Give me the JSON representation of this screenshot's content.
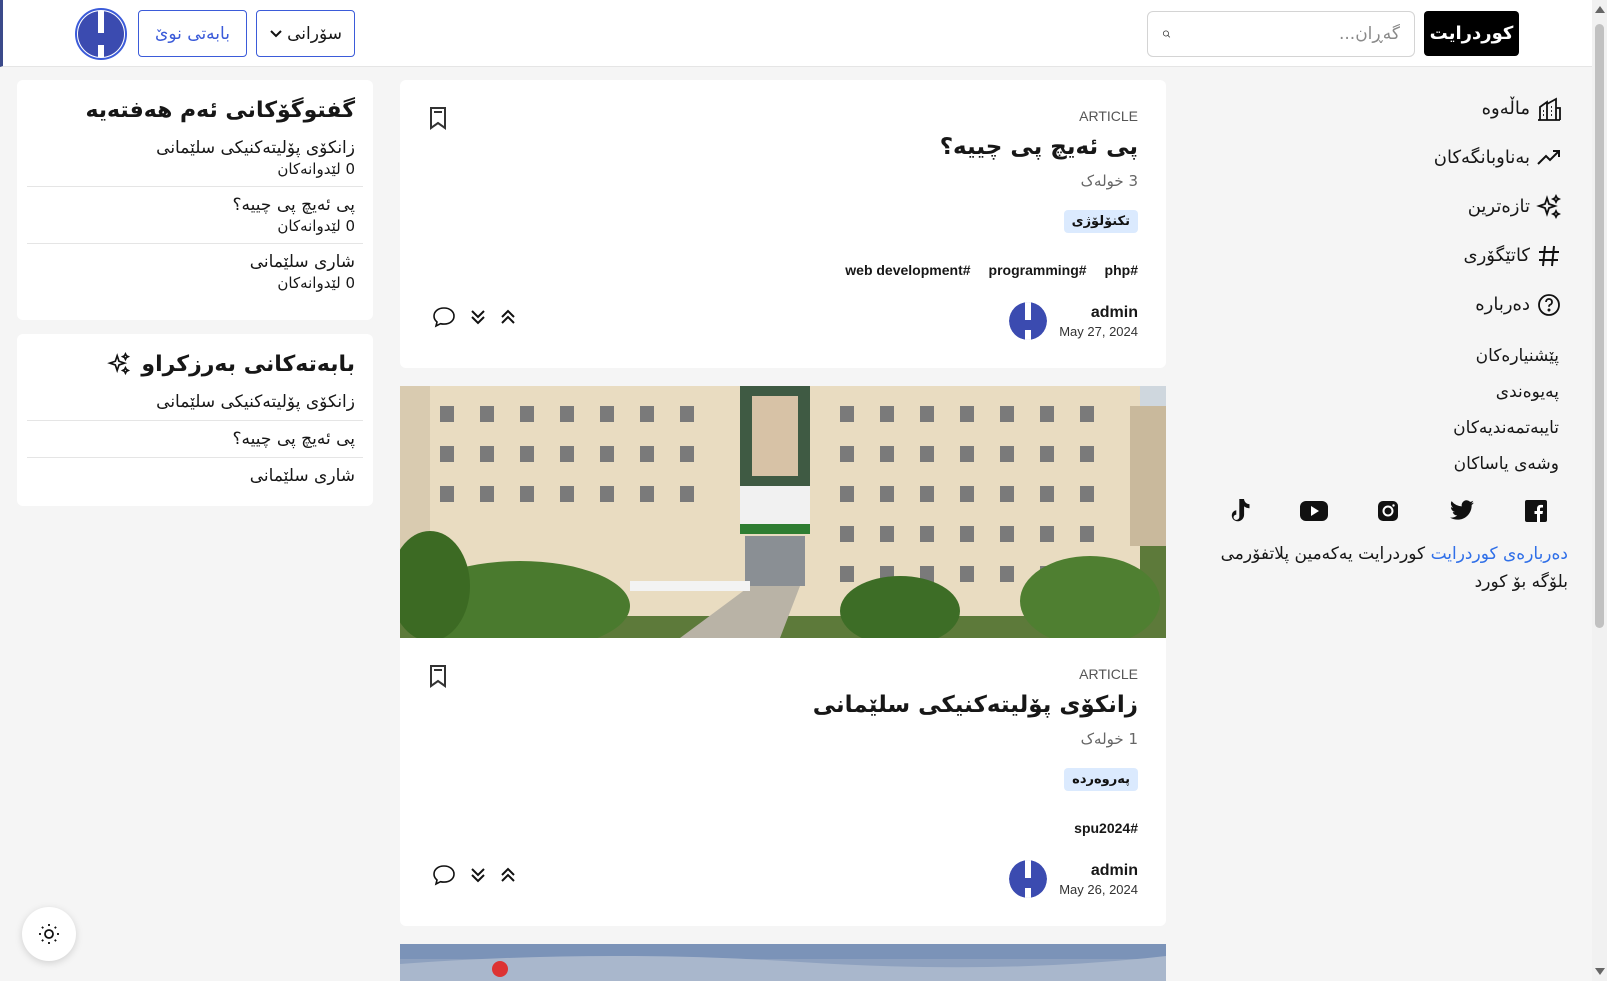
{
  "header": {
    "brand": "کوردرایت",
    "search_placeholder": "گەڕان...",
    "language_selected": "سۆرانی",
    "new_post_label": "بابەتی نوێ"
  },
  "nav": {
    "items": [
      {
        "label": "ماڵەوە",
        "icon": "home-icon"
      },
      {
        "label": "بەناوبانگەکان",
        "icon": "trending-icon"
      },
      {
        "label": "تازەترین",
        "icon": "sparkles-icon"
      },
      {
        "label": "کاتێگۆری",
        "icon": "hash-icon"
      },
      {
        "label": "دەربارە",
        "icon": "help-icon"
      }
    ],
    "links": [
      "پێشنیارەکان",
      "پەیوەندی",
      "تایبەتمەندیەکان",
      "وشەی یاساکان"
    ],
    "socials": [
      "facebook-icon",
      "twitter-icon",
      "instagram-icon",
      "youtube-icon",
      "tiktok-icon"
    ],
    "about_link": "دەربارەی کوردرایت",
    "about_text": "کوردرایت یەکەمین پلاتفۆرمی بلۆگە بۆ کورد"
  },
  "feed": {
    "posts": [
      {
        "type": "ARTICLE",
        "title": "پی ئەیچ پی چییە؟",
        "read_time": "3 خولەک",
        "category": "تکنۆلۆژی",
        "tags": [
          "web development#",
          "programming#",
          "php#"
        ],
        "author": "admin",
        "date": "May 27, 2024"
      },
      {
        "type": "ARTICLE",
        "title": "زانکۆی پۆلیتەکنیکی سلێمانی",
        "read_time": "1 خولەک",
        "category": "پەروەردە",
        "tags": [
          "spu2024#"
        ],
        "author": "admin",
        "date": "May 26, 2024"
      }
    ]
  },
  "widgets": {
    "discussions": {
      "title": "گفتوگۆکانی ئەم هەفتەیە",
      "items": [
        {
          "title": "زانکۆی پۆلیتەکنیکی سلێمانی",
          "count": "0 لێدوانەکان"
        },
        {
          "title": "پی ئەیچ پی چییە؟",
          "count": "0 لێدوانەکان"
        },
        {
          "title": "شاری سلێمانی",
          "count": "0 لێدوانەکان"
        }
      ]
    },
    "featured": {
      "title": "بابەتەکانی بەرزکراو",
      "items": [
        "زانکۆی پۆلیتەکنیکی سلێمانی",
        "پی ئەیچ پی چییە؟",
        "شاری سلێمانی"
      ]
    }
  },
  "colors": {
    "accent": "#3b5bd9",
    "link": "#2f6fe8",
    "category_bg": "#dbeafe"
  }
}
